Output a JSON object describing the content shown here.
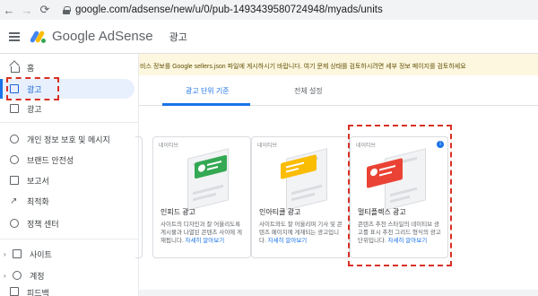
{
  "browser": {
    "url": "google.com/adsense/new/u/0/pub-1493439580724948/myads/units"
  },
  "header": {
    "brand_google": "Google",
    "brand_product": "AdSense",
    "title": "광고"
  },
  "sidebar": {
    "items": [
      {
        "label": "홈",
        "icon": "home-icon"
      },
      {
        "label": "광고",
        "icon": "ads-icon"
      },
      {
        "label": "광고",
        "icon": "ad-unit-icon"
      },
      {
        "label": "개인 정보 보호 및 메시지",
        "icon": "privacy-icon"
      },
      {
        "label": "브랜드 안전성",
        "icon": "brand-safety-icon"
      },
      {
        "label": "보고서",
        "icon": "reports-icon"
      },
      {
        "label": "최적화",
        "icon": "optimization-icon"
      },
      {
        "label": "정책 센터",
        "icon": "policy-center-icon"
      },
      {
        "label": "사이트",
        "icon": "sites-icon"
      },
      {
        "label": "계정",
        "icon": "account-icon"
      },
      {
        "label": "피드백",
        "icon": "feedback-icon"
      }
    ]
  },
  "notice": {
    "text": "비스 정보를 Google sellers.json 파일에 게시하시기 바랍니다. 여기 문제 상태를 검토하시려면 세부 정보 페이지를 검토하세요"
  },
  "tabs": [
    {
      "label": "광고 단위 기준"
    },
    {
      "label": "전체 설정"
    }
  ],
  "cards": [
    {
      "tag": "네이티브",
      "title": "인피드 광고",
      "desc": "사이트의 디자인과 잘 어울리도록 게시물과 나열된 콘텐츠 사이에 게재됩니다.",
      "link": "자세히 알아보기",
      "banner_color": "#34a853"
    },
    {
      "tag": "네이티브",
      "title": "인아티클 광고",
      "desc": "사이트와도 잘 어울리며 기사 및 콘텐츠 페이지에 게재되는 광고입니다.",
      "link": "자세히 알아보기",
      "banner_color": "#fbbc04"
    },
    {
      "tag": "네이티브",
      "title": "멀티플렉스 광고",
      "desc": "콘텐츠 추천 스타일의 네이티브 광고를 표시 추천 그리드 형식의 광고 단위입니다.",
      "link": "자세히 알아보기",
      "banner_color": "#ea4335"
    }
  ],
  "colors": {
    "accent": "#1a73e8",
    "highlight": "#d93025",
    "notice_bg": "#fef7e0"
  }
}
